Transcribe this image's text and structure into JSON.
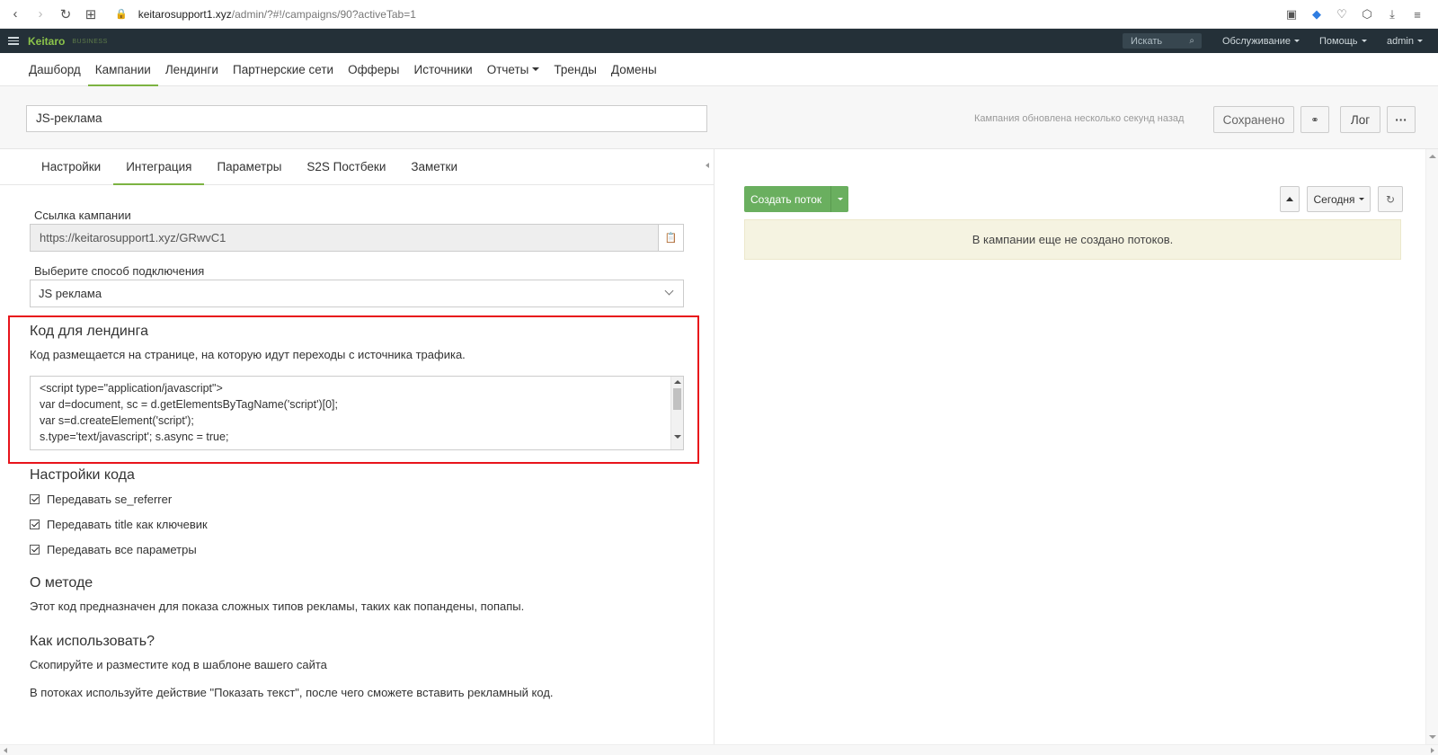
{
  "browser": {
    "url_host": "keitarosupport1.xyz",
    "url_path": "/admin/?#!/campaigns/90?activeTab=1",
    "icons": [
      "back-icon",
      "forward-icon",
      "reload-icon",
      "apps-icon",
      "lock-icon",
      "camera-icon",
      "shield-icon",
      "heart-icon",
      "box-icon",
      "download-icon",
      "menu-icon"
    ]
  },
  "topbar": {
    "logo": "Keitaro",
    "edition": "BUSINESS",
    "search_placeholder": "Искать",
    "menu": [
      "Обслуживание",
      "Помощь",
      "admin"
    ],
    "bg_color": "#243038",
    "logo_color": "#8bc34a"
  },
  "mainnav": {
    "items": [
      "Дашборд",
      "Кампании",
      "Лендинги",
      "Партнерские сети",
      "Офферы",
      "Источники",
      "Отчеты",
      "Тренды",
      "Домены"
    ],
    "active": "Кампании"
  },
  "campaign": {
    "name": "JS-реклама",
    "updated_text": "Кампания обновлена несколько секунд назад",
    "saved_label": "Сохранено",
    "log_label": "Лог",
    "more_label": "···"
  },
  "subtabs": {
    "items": [
      "Настройки",
      "Интеграция",
      "Параметры",
      "S2S Постбеки",
      "Заметки"
    ],
    "active": "Интеграция"
  },
  "integration": {
    "link_label": "Ссылка кампании",
    "link_value": "https://keitarosupport1.xyz/GRwvC1",
    "method_label": "Выберите способ подключения",
    "method_value": "JS реклама",
    "landing_title": "Код для лендинга",
    "landing_desc": "Код размещается на странице, на которую идут переходы с источника трафика.",
    "code_lines": [
      "<script type=\"application/javascript\">",
      "var d=document, sc = d.getElementsByTagName('script')[0];",
      "var s=d.createElement('script');",
      "s.type='text/javascript'; s.async = true;"
    ],
    "settings_title": "Настройки кода",
    "options": [
      "Передавать se_referrer",
      "Передавать title как ключевик",
      "Передавать все параметры"
    ],
    "about_title": "О методе",
    "about_text": "Этот код предназначен для показа сложных типов рекламы, таких как попандены, попапы.",
    "howto_title": "Как использовать?",
    "howto_text1": "Скопируйте и разместите код в шаблоне вашего сайта",
    "howto_text2": "В потоках используйте действие \"Показать текст\", после чего сможете вставить рекламный код."
  },
  "streams": {
    "create_label": "Создать поток",
    "period_label": "Сегодня",
    "empty_text": "В кампании еще не создано потоков.",
    "create_color": "#6aaf5f",
    "alert_color": "#f5f3e1"
  },
  "highlight_color": "#e8141b"
}
